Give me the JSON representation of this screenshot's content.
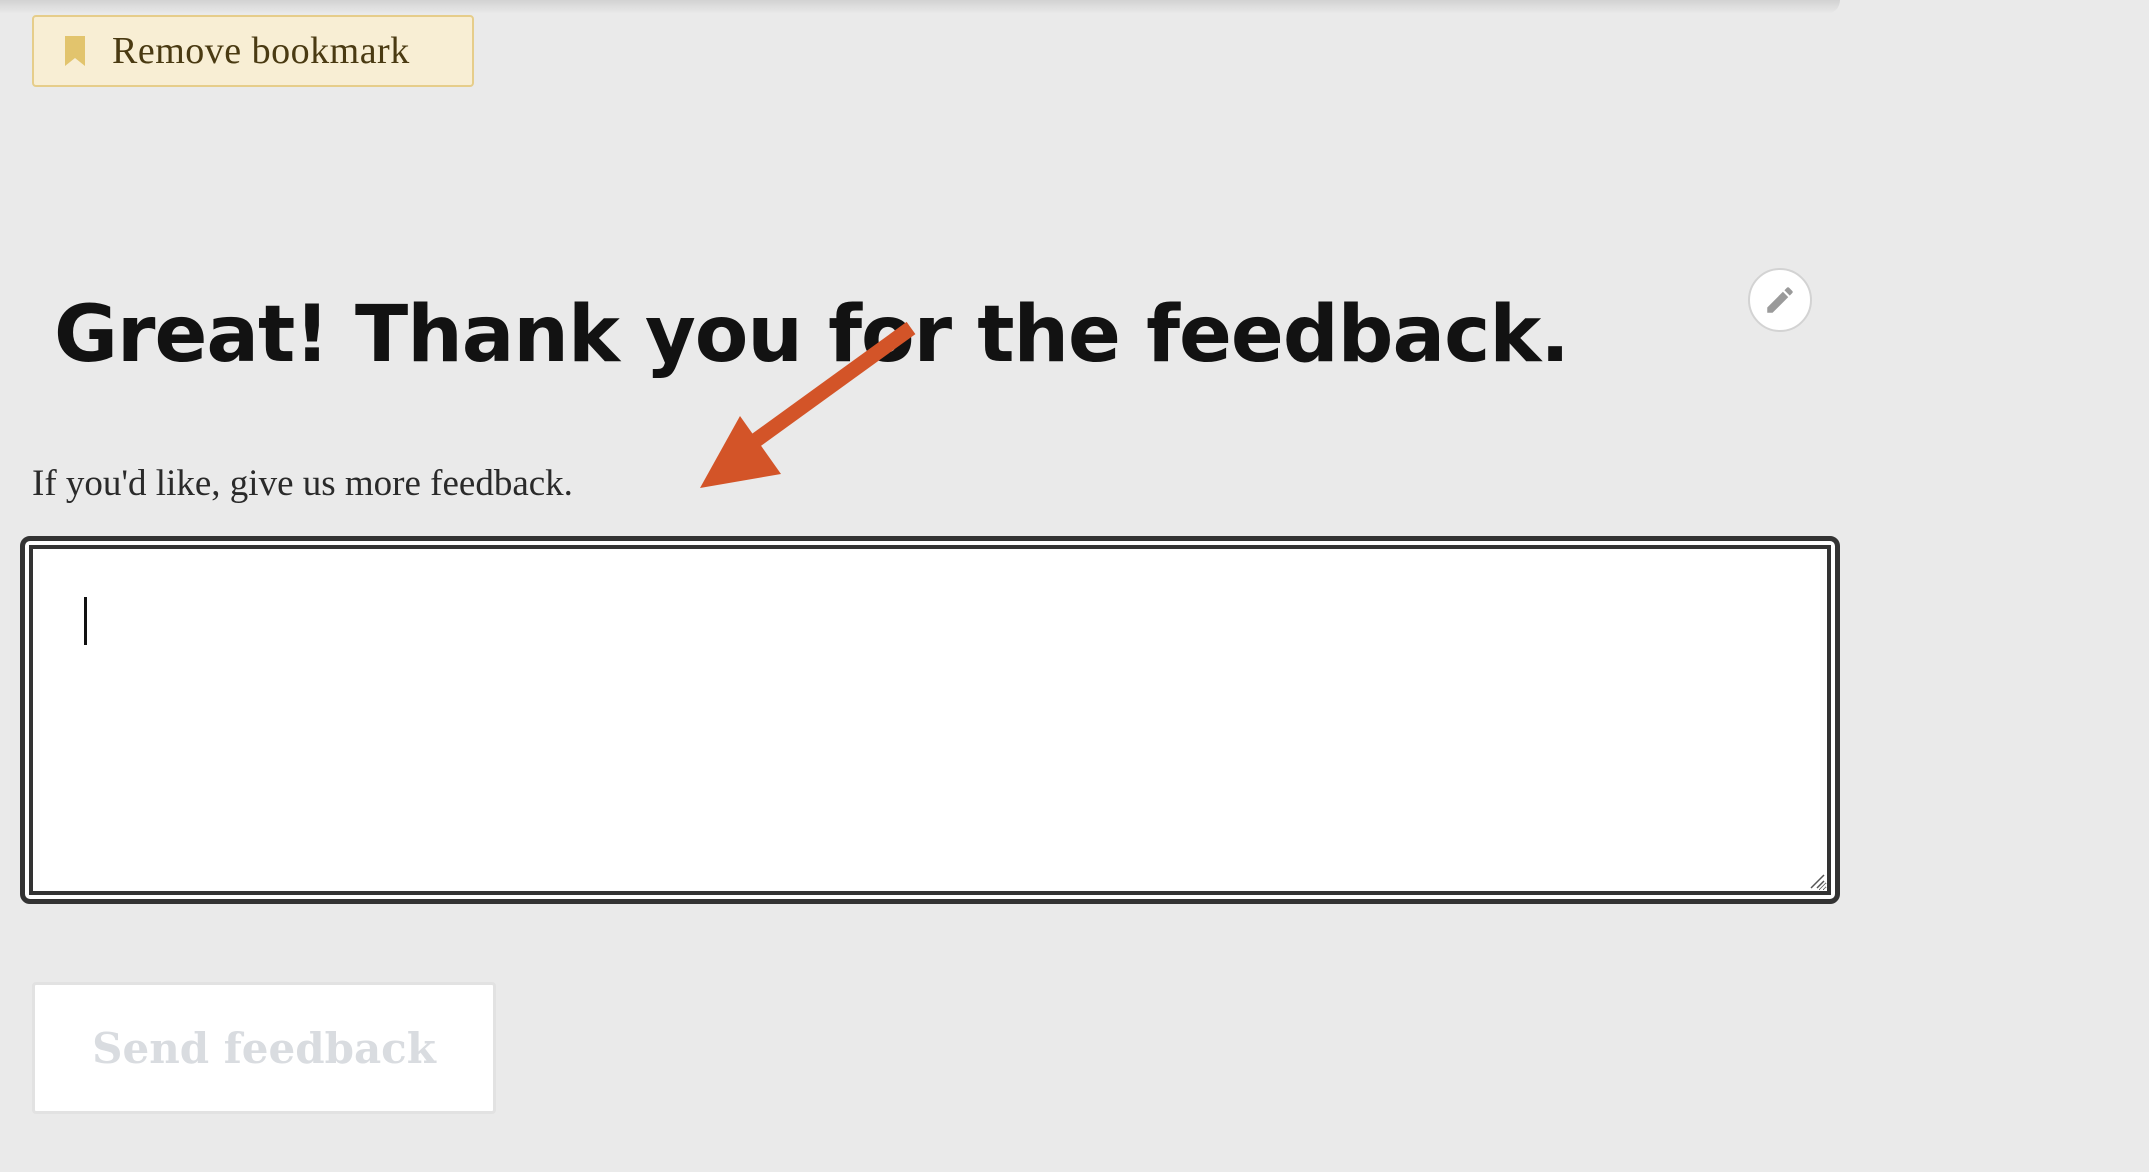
{
  "bookmark": {
    "label": "Remove bookmark",
    "icon": "bookmark-icon"
  },
  "edit": {
    "icon": "pencil-icon"
  },
  "heading": {
    "title": "Great! Thank you for the feedback.",
    "prompt": "If you'd like, give us more feedback."
  },
  "feedback": {
    "value": "",
    "placeholder": ""
  },
  "send": {
    "label": "Send feedback",
    "disabled": true
  },
  "annotation": {
    "icon": "arrow-icon",
    "color": "#d35428"
  },
  "colors": {
    "background": "#eaeaea",
    "bookmark_bg": "#f8eed4",
    "bookmark_accent": "#e2c46d"
  }
}
